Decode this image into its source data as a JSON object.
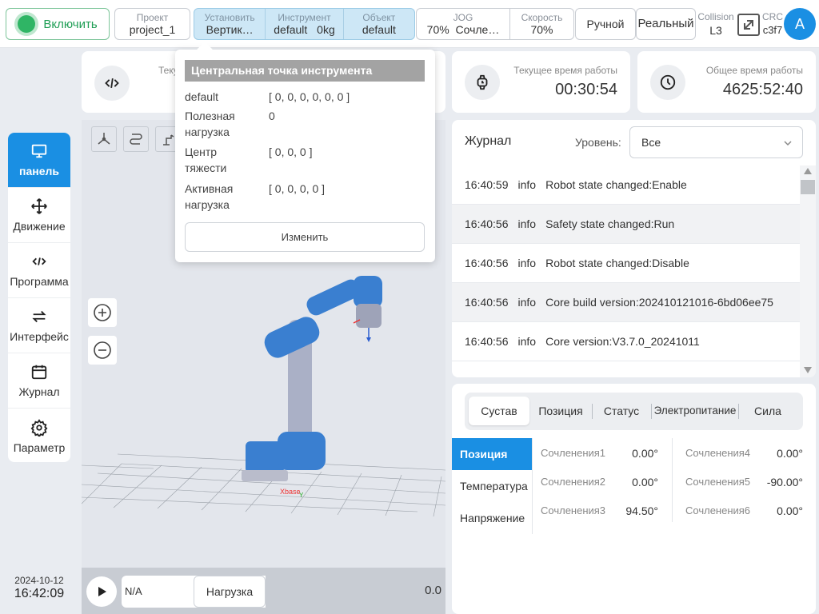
{
  "topbar": {
    "enable_label": "Включить",
    "project": {
      "label": "Проект",
      "value": "project_1"
    },
    "tool": {
      "install": {
        "label": "Установить",
        "value": "Вертик…"
      },
      "instrument": {
        "label": "Инструмент",
        "value": "default",
        "mass": "0kg"
      },
      "object": {
        "label": "Объект",
        "value": "default"
      }
    },
    "jog": {
      "label": "JOG",
      "value": "70%",
      "extra": "Сочле…"
    },
    "speed": {
      "label": "Скорость",
      "value": "70%"
    },
    "mode_button": "Ручной",
    "real_button": "Реальный",
    "collision": {
      "label": "Collision",
      "value": "L3"
    },
    "crc": {
      "label": "CRC",
      "value": "c3f7"
    },
    "avatar_letter": "A"
  },
  "sidebar": {
    "items": [
      {
        "label": "панель",
        "icon": "monitor-icon"
      },
      {
        "label": "Движение",
        "icon": "move-icon"
      },
      {
        "label": "Программа",
        "icon": "code-icon"
      },
      {
        "label": "Интерфейс",
        "icon": "swap-icon"
      },
      {
        "label": "Журнал",
        "icon": "calendar-icon"
      },
      {
        "label": "Параметр",
        "icon": "gear-icon"
      }
    ]
  },
  "program_card": {
    "label": "Теку"
  },
  "runtime": {
    "current": {
      "label": "Текущее время работы",
      "value": "00:30:54"
    },
    "total": {
      "label": "Общее время работы",
      "value": "4625:52:40"
    }
  },
  "popup": {
    "title": "Центральная точка инструмента",
    "rows": [
      {
        "name": "default",
        "value": "[ 0, 0, 0, 0, 0, 0 ]"
      },
      {
        "name": "Полезная\nнагрузка",
        "value": "0"
      },
      {
        "name": "Центр\nтяжести",
        "value": "[ 0, 0, 0 ]"
      },
      {
        "name": "Активная\nнагрузка",
        "value": "[ 0, 0, 0, 0 ]"
      }
    ],
    "edit_button": "Изменить"
  },
  "journal": {
    "title": "Журнал",
    "level_label": "Уровень:",
    "level_value": "Все",
    "entries": [
      {
        "time": "16:40:59",
        "level": "info",
        "msg": "Robot state changed:Enable"
      },
      {
        "time": "16:40:56",
        "level": "info",
        "msg": "Safety state changed:Run"
      },
      {
        "time": "16:40:56",
        "level": "info",
        "msg": "Robot state changed:Disable"
      },
      {
        "time": "16:40:56",
        "level": "info",
        "msg": "Core build version:202410121016-6bd06ee75"
      },
      {
        "time": "16:40:56",
        "level": "info",
        "msg": "Core version:V3.7.0_20241011"
      }
    ]
  },
  "status_panel": {
    "tabs": [
      "Сустав",
      "Позиция",
      "Статус",
      "Электропитание",
      "Сила"
    ],
    "side_tabs": [
      "Позиция",
      "Температура",
      "Напряжение"
    ],
    "joints": [
      {
        "label": "Сочленения1",
        "value": "0.00°"
      },
      {
        "label": "Сочленения2",
        "value": "0.00°"
      },
      {
        "label": "Сочленения3",
        "value": "94.50°"
      },
      {
        "label": "Сочленения4",
        "value": "0.00°"
      },
      {
        "label": "Сочленения5",
        "value": "-90.00°"
      },
      {
        "label": "Сочленения6",
        "value": "0.00°"
      }
    ]
  },
  "view": {
    "program_value": "N/A",
    "load_button": "Нагрузка",
    "speed_value": "0.0"
  },
  "clock": {
    "date": "2024-10-12",
    "time": "16:42:09"
  },
  "colors": {
    "accent": "#1a8fe3",
    "enable_green": "#2fb565",
    "robot_blue": "#3a7fd0"
  }
}
